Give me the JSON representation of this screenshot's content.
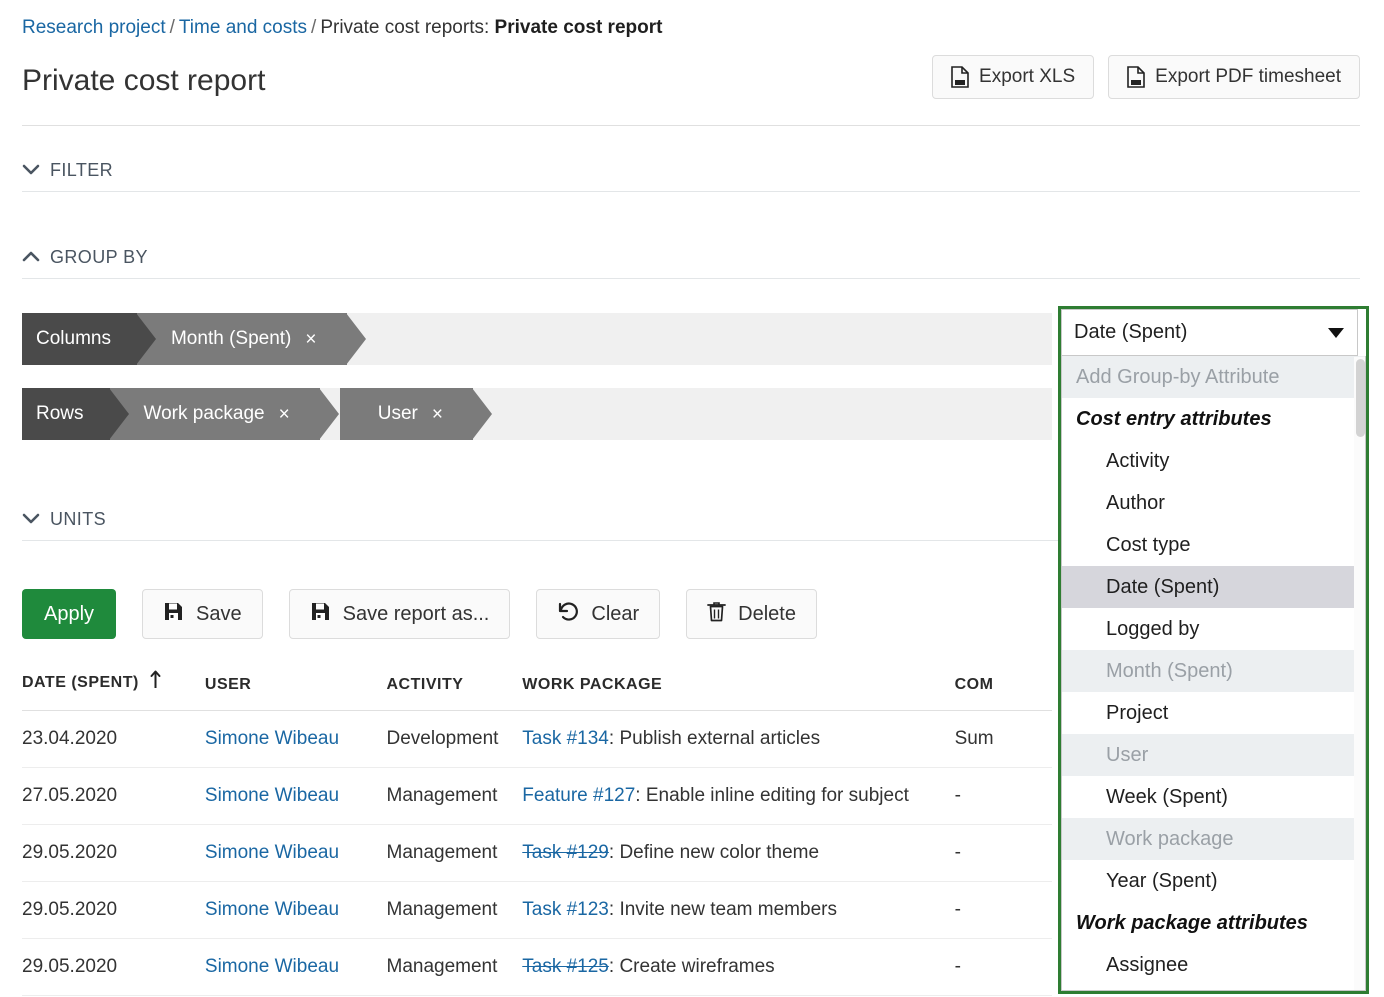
{
  "breadcrumb": {
    "project": "Research project",
    "section": "Time and costs",
    "label": "Private cost reports:",
    "current": "Private cost report",
    "separator": "/"
  },
  "header": {
    "title": "Private cost report",
    "export_xls": "Export XLS",
    "export_pdf": "Export PDF timesheet"
  },
  "sections": {
    "filter": {
      "label": "FILTER",
      "expanded": false
    },
    "group_by": {
      "label": "GROUP BY",
      "expanded": true
    },
    "units": {
      "label": "UNITS",
      "expanded": false
    }
  },
  "group_by": {
    "columns": {
      "label": "Columns",
      "chips": [
        {
          "label": "Month (Spent)",
          "remove": "×"
        }
      ]
    },
    "rows": {
      "label": "Rows",
      "chips": [
        {
          "label": "Work package",
          "remove": "×"
        },
        {
          "label": "User",
          "remove": "×"
        }
      ]
    }
  },
  "actions": {
    "apply": "Apply",
    "save": "Save",
    "save_as": "Save report as...",
    "clear": "Clear",
    "delete": "Delete"
  },
  "dropdown": {
    "selected": "Date (Spent)",
    "placeholder": "Add Group-by Attribute",
    "options": [
      {
        "label": "Add Group-by Attribute",
        "type": "placeholder"
      },
      {
        "label": "Cost entry attributes",
        "type": "group"
      },
      {
        "label": "Activity",
        "type": "option"
      },
      {
        "label": "Author",
        "type": "option"
      },
      {
        "label": "Cost type",
        "type": "option"
      },
      {
        "label": "Date (Spent)",
        "type": "selected"
      },
      {
        "label": "Logged by",
        "type": "option"
      },
      {
        "label": "Month (Spent)",
        "type": "disabled"
      },
      {
        "label": "Project",
        "type": "option"
      },
      {
        "label": "User",
        "type": "disabled"
      },
      {
        "label": "Week (Spent)",
        "type": "option"
      },
      {
        "label": "Work package",
        "type": "disabled"
      },
      {
        "label": "Year (Spent)",
        "type": "option"
      },
      {
        "label": "Work package attributes",
        "type": "group"
      },
      {
        "label": "Assignee",
        "type": "option"
      }
    ]
  },
  "table": {
    "columns": [
      "DATE (SPENT)",
      "USER",
      "ACTIVITY",
      "WORK PACKAGE",
      "COM"
    ],
    "sort_column": "DATE (SPENT)",
    "sort_direction": "asc",
    "rows": [
      {
        "date": "23.04.2020",
        "user": "Simone Wibeau",
        "activity": "Development",
        "wp_id": "Task #134",
        "wp_closed": false,
        "wp_subject": ": Publish external articles",
        "comment": "Sum"
      },
      {
        "date": "27.05.2020",
        "user": "Simone Wibeau",
        "activity": "Management",
        "wp_id": "Feature #127",
        "wp_closed": false,
        "wp_subject": ": Enable inline editing for subject",
        "comment": "-"
      },
      {
        "date": "29.05.2020",
        "user": "Simone Wibeau",
        "activity": "Management",
        "wp_id": "Task #129",
        "wp_closed": true,
        "wp_subject": ": Define new color theme",
        "comment": "-"
      },
      {
        "date": "29.05.2020",
        "user": "Simone Wibeau",
        "activity": "Management",
        "wp_id": "Task #123",
        "wp_closed": false,
        "wp_subject": ": Invite new team members",
        "comment": "-"
      },
      {
        "date": "29.05.2020",
        "user": "Simone Wibeau",
        "activity": "Management",
        "wp_id": "Task #125",
        "wp_closed": true,
        "wp_subject": ": Create wireframes",
        "comment": "-"
      }
    ]
  },
  "colors": {
    "link": "#1a67a3",
    "apply_green": "#1f8a3c",
    "highlight_border": "#2e7d32",
    "chip_dark": "#4a4a4a",
    "chip_grey": "#7b7b7b"
  }
}
